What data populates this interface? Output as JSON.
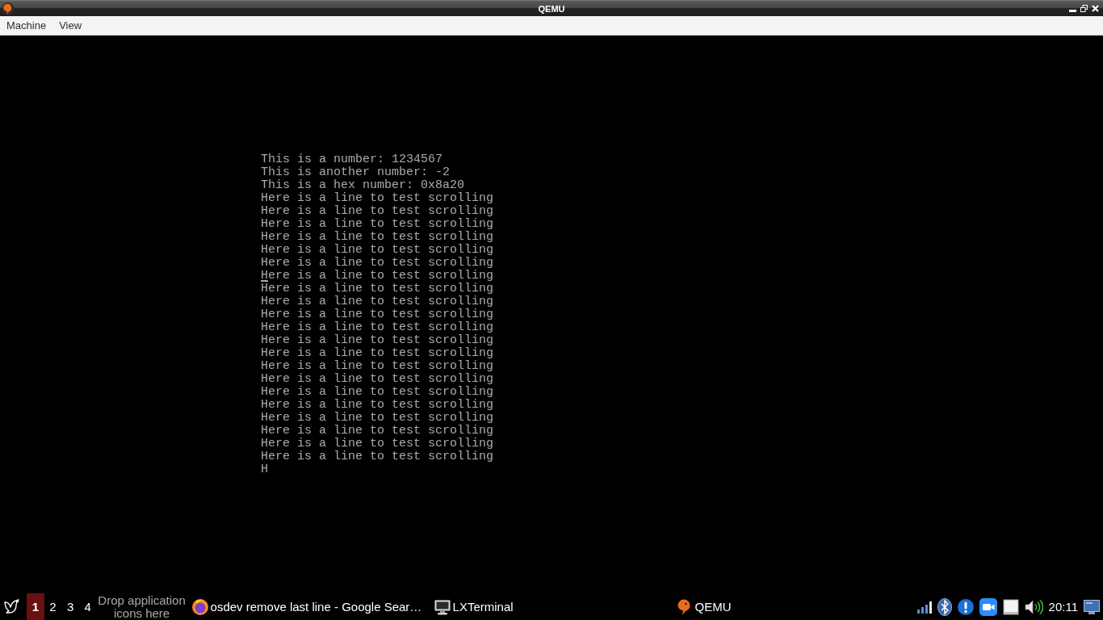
{
  "window": {
    "title": "QEMU"
  },
  "menu_bar": [
    {
      "label": "Machine"
    },
    {
      "label": "View"
    }
  ],
  "console": {
    "lines": [
      {
        "text": "This is a number: 1234567",
        "cursor": false
      },
      {
        "text": "This is another number: -2",
        "cursor": false
      },
      {
        "text": "This is a hex number: 0x8a20",
        "cursor": false
      },
      {
        "text": "Here is a line to test scrolling",
        "cursor": false
      },
      {
        "text": "Here is a line to test scrolling",
        "cursor": false
      },
      {
        "text": "Here is a line to test scrolling",
        "cursor": false
      },
      {
        "text": "Here is a line to test scrolling",
        "cursor": false
      },
      {
        "text": "Here is a line to test scrolling",
        "cursor": false
      },
      {
        "text": "Here is a line to test scrolling",
        "cursor": false
      },
      {
        "text": "Here is a line to test scrolling",
        "cursor": true
      },
      {
        "text": "Here is a line to test scrolling",
        "cursor": false
      },
      {
        "text": "Here is a line to test scrolling",
        "cursor": false
      },
      {
        "text": "Here is a line to test scrolling",
        "cursor": false
      },
      {
        "text": "Here is a line to test scrolling",
        "cursor": false
      },
      {
        "text": "Here is a line to test scrolling",
        "cursor": false
      },
      {
        "text": "Here is a line to test scrolling",
        "cursor": false
      },
      {
        "text": "Here is a line to test scrolling",
        "cursor": false
      },
      {
        "text": "Here is a line to test scrolling",
        "cursor": false
      },
      {
        "text": "Here is a line to test scrolling",
        "cursor": false
      },
      {
        "text": "Here is a line to test scrolling",
        "cursor": false
      },
      {
        "text": "Here is a line to test scrolling",
        "cursor": false
      },
      {
        "text": "Here is a line to test scrolling",
        "cursor": false
      },
      {
        "text": "Here is a line to test scrolling",
        "cursor": false
      },
      {
        "text": "Here is a line to test scrolling",
        "cursor": false
      },
      {
        "text": "H",
        "cursor": false
      }
    ]
  },
  "taskbar": {
    "workspaces": [
      {
        "label": "1",
        "selected": true
      },
      {
        "label": "2",
        "selected": false
      },
      {
        "label": "3",
        "selected": false
      },
      {
        "label": "4",
        "selected": false
      }
    ],
    "launcher_hint": "Drop application icons here",
    "tasks": [
      {
        "label": "osdev remove last line - Google Sear…",
        "kind": "browser"
      },
      {
        "label": "LXTerminal",
        "kind": "terminal"
      },
      {
        "label": "QEMU",
        "kind": "emulator"
      }
    ],
    "clock": "20:11"
  }
}
